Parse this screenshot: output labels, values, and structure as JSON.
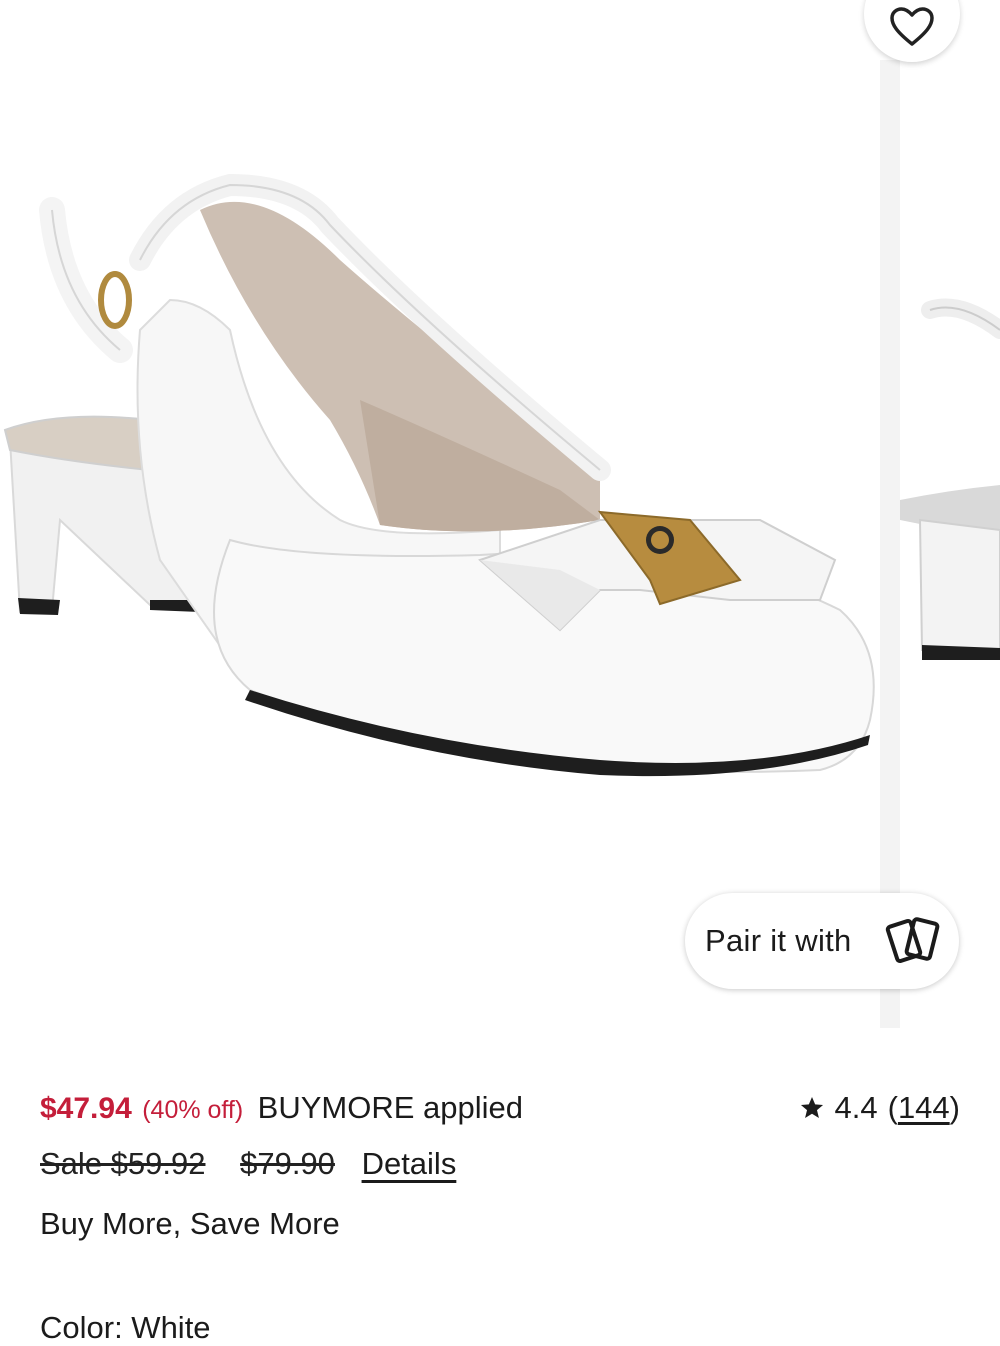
{
  "gallery": {
    "main_image_alt": "",
    "favorite_icon": "heart-icon",
    "pair_button": {
      "label": "Pair it with",
      "icon": "cards-icon"
    }
  },
  "pricing": {
    "sale_price": "$47.94",
    "percent_off": "(40% off)",
    "promo_applied": "BUYMORE applied",
    "previous_sale_price": "Sale $59.92",
    "original_price": "$79.90",
    "details_link": "Details",
    "promo_message": "Buy More, Save More",
    "price_color": "#c41e3a"
  },
  "rating": {
    "icon": "star-icon",
    "value": "4.4",
    "open_paren": "(",
    "review_count": "144",
    "close_paren": ")"
  },
  "color": {
    "label": "Color: White"
  }
}
